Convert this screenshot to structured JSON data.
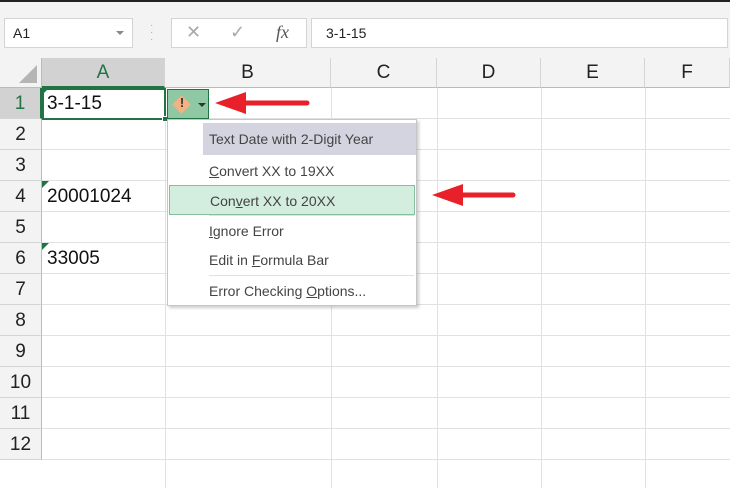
{
  "formula_bar": {
    "name_box": "A1",
    "cancel_icon": "✕",
    "enter_icon": "✓",
    "fx_label": "fx",
    "formula": "3-1-15"
  },
  "columns": [
    "A",
    "B",
    "C",
    "D",
    "E",
    "F"
  ],
  "rows": [
    "1",
    "2",
    "3",
    "4",
    "5",
    "6",
    "7",
    "8",
    "9",
    "10",
    "11",
    "12"
  ],
  "cells": {
    "A1": "3-1-15",
    "A4": "20001024",
    "A6": "33005"
  },
  "error_menu": {
    "title": "Text Date with 2-Digit Year",
    "items": [
      {
        "pre": "",
        "key": "C",
        "post": "onvert XX to 19XX"
      },
      {
        "pre": "Con",
        "key": "v",
        "post": "ert XX to 20XX"
      },
      {
        "pre": "",
        "key": "I",
        "post": "gnore Error"
      },
      {
        "pre": "Edit in ",
        "key": "F",
        "post": "ormula Bar"
      },
      {
        "pre": "Error Checking ",
        "key": "O",
        "post": "ptions..."
      }
    ]
  },
  "colors": {
    "accent": "#217346",
    "arrow": "#e8202a"
  }
}
